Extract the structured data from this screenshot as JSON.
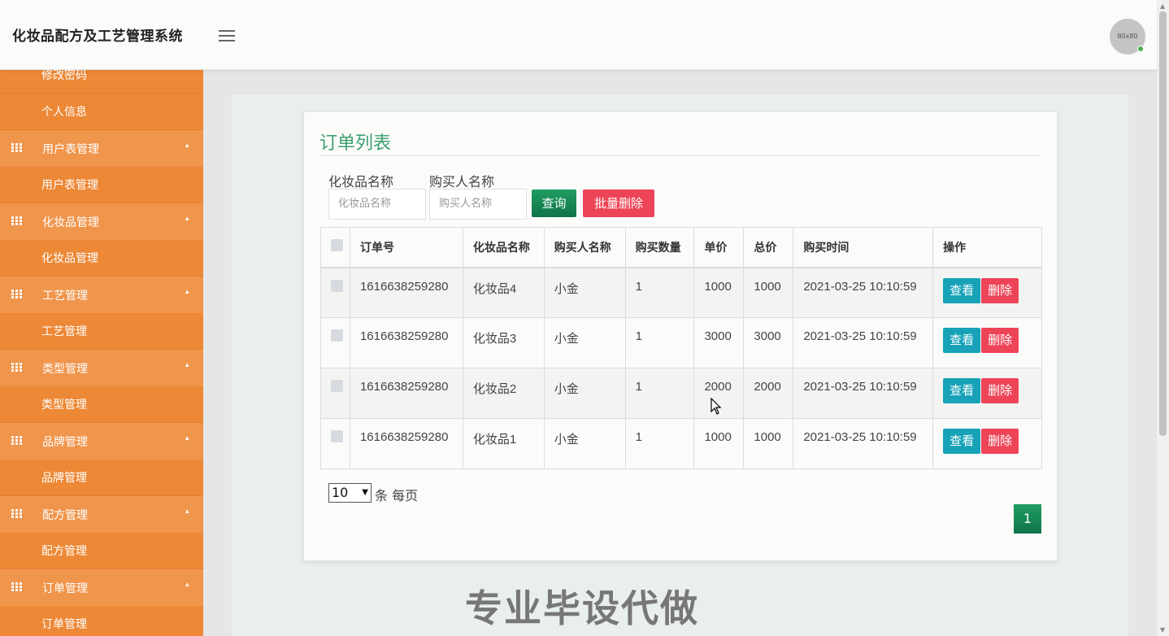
{
  "header": {
    "title": "化妆品配方及工艺管理系统",
    "avatar_text": "80x80"
  },
  "sidebar": {
    "items": [
      {
        "type": "sub",
        "label": "修改密码"
      },
      {
        "type": "sub",
        "label": "个人信息"
      },
      {
        "type": "group",
        "label": "用户表管理"
      },
      {
        "type": "sub",
        "label": "用户表管理"
      },
      {
        "type": "group",
        "label": "化妆品管理"
      },
      {
        "type": "sub",
        "label": "化妆品管理"
      },
      {
        "type": "group",
        "label": "工艺管理"
      },
      {
        "type": "sub",
        "label": "工艺管理"
      },
      {
        "type": "group",
        "label": "类型管理"
      },
      {
        "type": "sub",
        "label": "类型管理"
      },
      {
        "type": "group",
        "label": "品牌管理"
      },
      {
        "type": "sub",
        "label": "品牌管理"
      },
      {
        "type": "group",
        "label": "配方管理"
      },
      {
        "type": "sub",
        "label": "配方管理"
      },
      {
        "type": "group",
        "label": "订单管理"
      },
      {
        "type": "sub",
        "label": "订单管理"
      }
    ]
  },
  "card": {
    "title": "订单列表",
    "filters": {
      "product_label": "化妆品名称",
      "product_placeholder": "化妆品名称",
      "buyer_label": "购买人名称",
      "buyer_placeholder": "购买人名称",
      "query_label": "查询",
      "bulk_delete_label": "批量删除"
    },
    "table": {
      "headers": [
        "订单号",
        "化妆品名称",
        "购买人名称",
        "购买数量",
        "单价",
        "总价",
        "购买时间",
        "操作"
      ],
      "rows": [
        [
          "1616638259280",
          "化妆品4",
          "小金",
          "1",
          "1000",
          "1000",
          "2021-03-25 10:10:59"
        ],
        [
          "1616638259280",
          "化妆品3",
          "小金",
          "1",
          "3000",
          "3000",
          "2021-03-25 10:10:59"
        ],
        [
          "1616638259280",
          "化妆品2",
          "小金",
          "1",
          "2000",
          "2000",
          "2021-03-25 10:10:59"
        ],
        [
          "1616638259280",
          "化妆品1",
          "小金",
          "1",
          "1000",
          "1000",
          "2021-03-25 10:10:59"
        ]
      ],
      "view_label": "查看",
      "delete_label": "删除"
    },
    "pager": {
      "page_size": "10",
      "per_page_label": "条 每页",
      "current_page": "1"
    }
  },
  "watermark": "专业毕设代做",
  "colors": {
    "sidebar": "#e8883a",
    "primary_green": "#1f9d60",
    "danger": "#ee4458",
    "info": "#17a2b8",
    "title_green": "#3aa06d"
  }
}
